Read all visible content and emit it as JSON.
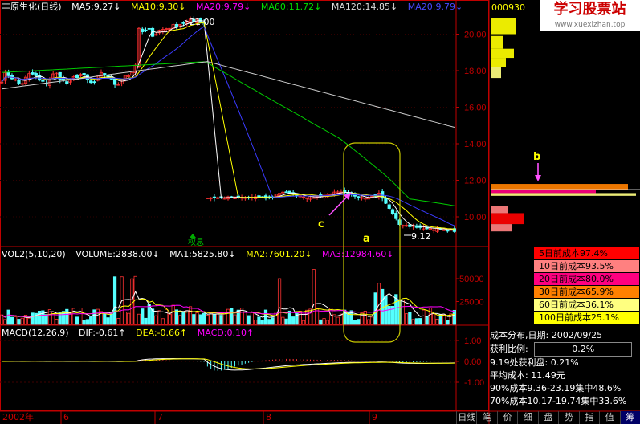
{
  "legend_top": {
    "name": "丰原生化(日线)",
    "ma5": "MA5:9.27↓",
    "ma10": "MA10:9.30↓",
    "ma20": "MA20:9.79↓",
    "ma60": "MA60:11.72↓",
    "ma120": "MA120:14.85↓",
    "ma20b": "MA20:9.79↓"
  },
  "legend_vol": {
    "name": "VOL2(5,10,20)",
    "volume": "VOLUME:2838.00↓",
    "ma1": "MA1:5825.80↓",
    "ma2": "MA2:7601.20↓",
    "ma3": "MA3:12984.60↓"
  },
  "legend_macd": {
    "name": "MACD(12,26,9)",
    "dif": "DIF:-0.61↑",
    "dea": "DEA:-0.66↑",
    "macd": "MACD:0.10↑"
  },
  "stock_code": "000930",
  "watermark": {
    "title": "学习股票站",
    "url": "www.xuexizhan.top"
  },
  "annotations": {
    "high": "21.00",
    "low": "9.12",
    "xr": "权息",
    "a": "a",
    "b": "b",
    "c": "c"
  },
  "x_axis": [
    "2002年",
    "6",
    "7",
    "8",
    "9"
  ],
  "cost_table": [
    {
      "label": "5日前成本97.4%",
      "color": "#ff0000"
    },
    {
      "label": "10日前成本93.5%",
      "color": "#ff8080"
    },
    {
      "label": "20日前成本80.0%",
      "color": "#ff0080"
    },
    {
      "label": "30日前成本65.9%",
      "color": "#ff8000"
    },
    {
      "label": "60日前成本36.1%",
      "color": "#ffff80"
    },
    {
      "label": "100日前成本25.1%",
      "color": "#ffff00"
    }
  ],
  "info": {
    "title": "成本分布,日期: 2002/09/25",
    "profit_label": "获利比例:",
    "profit_value": "0.2%",
    "line1": "9.19处获利盘: 0.21%",
    "line2": "平均成本: 11.49元",
    "line3": "90%成本9.36-23.19集中48.6%",
    "line4": "70%成本10.17-19.74集中33.6%"
  },
  "tabs": [
    "日线",
    "笔",
    "价",
    "细",
    "盘",
    "势",
    "指",
    "值",
    "筹"
  ],
  "colors": {
    "up": "#ff3232",
    "down": "#54ffff",
    "ma5": "#ffffff",
    "ma10": "#ffff00",
    "ma20": "#ff00ff",
    "ma60": "#00cc00",
    "ma120": "#cccccc",
    "ma20b": "#3b3bff",
    "axis": "#c00000",
    "highlight": "#c8c800",
    "arrow": "#ff50ff"
  },
  "chart_data": [
    {
      "type": "candlestick",
      "title": "丰原生化(日线)",
      "yticks": [
        10.0,
        12.0,
        14.0,
        16.0,
        18.0,
        20.0
      ],
      "ylim": [
        9.0,
        21.0
      ],
      "high": 21.0,
      "low": 9.12,
      "segments": [
        {
          "from": 0,
          "to": 38,
          "level": 17.6,
          "desc": "consolidation"
        },
        {
          "from": 39,
          "to": 59,
          "level": 17.8,
          "desc": "rally to 21.00"
        },
        {
          "from": 60,
          "to": 132,
          "level": 11.1,
          "desc": "post ex-rights"
        }
      ],
      "ma_series": [
        {
          "name": "MA5",
          "value": 9.27
        },
        {
          "name": "MA10",
          "value": 9.3
        },
        {
          "name": "MA20",
          "value": 9.79
        },
        {
          "name": "MA60",
          "value": 11.72
        },
        {
          "name": "MA120",
          "value": 14.85
        }
      ]
    },
    {
      "type": "bar",
      "title": "VOL2(5,10,20)",
      "yticks": [
        25000,
        50000
      ],
      "ylim": [
        0,
        60000
      ],
      "last_volume": 2838.0,
      "series": [
        {
          "name": "MA1",
          "value": 5825.8
        },
        {
          "name": "MA2",
          "value": 7601.2
        },
        {
          "name": "MA3",
          "value": 12984.6
        }
      ]
    },
    {
      "type": "bar",
      "title": "MACD(12,26,9)",
      "yticks": [
        -1.0,
        0.0,
        1.0
      ],
      "ylim": [
        -1.6,
        1.3
      ],
      "series": [
        {
          "name": "DIF",
          "value": -0.61
        },
        {
          "name": "DEA",
          "value": -0.66
        },
        {
          "name": "MACD",
          "value": 0.1
        }
      ]
    }
  ]
}
